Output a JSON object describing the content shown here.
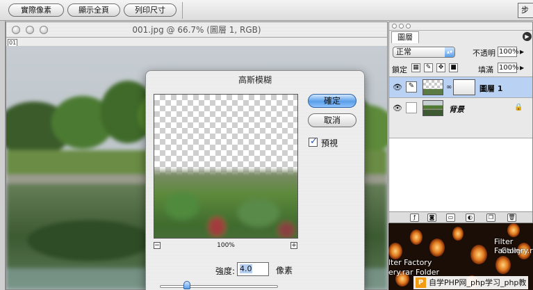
{
  "toolbar": {
    "actual_pixels": "實際像素",
    "fit_on_screen": "顯示全頁",
    "print_size": "列印尺寸",
    "right_clip": "步"
  },
  "document": {
    "title": "001.jpg @ 66.7% (圖層 1, RGB)",
    "tag": "01"
  },
  "dialog": {
    "title": "高斯模糊",
    "ok": "確定",
    "cancel": "取消",
    "preview_label": "預視",
    "preview_checked": true,
    "zoom_out": "−",
    "zoom_in": "+",
    "zoom": "100%",
    "strength_label": "強度:",
    "strength_value": "4.0",
    "strength_unit": "像素",
    "slider_fraction": 0.23
  },
  "layers": {
    "tab": "圖層",
    "blend_mode": "正常",
    "opacity_label": "不透明",
    "opacity_value": "100%",
    "lock_label": "鎖定",
    "fill_label": "填滿",
    "fill_value": "100%",
    "items": [
      {
        "name": "圖層 1",
        "selected": true
      },
      {
        "name": "背景",
        "locked": true
      }
    ]
  },
  "background": {
    "text1": "Filter Factory",
    "text2": "Gallery.r",
    "text3": "lter Factory",
    "text4": "ery.rar Folder"
  },
  "watermark": "自学PHP网_php学习_php教"
}
